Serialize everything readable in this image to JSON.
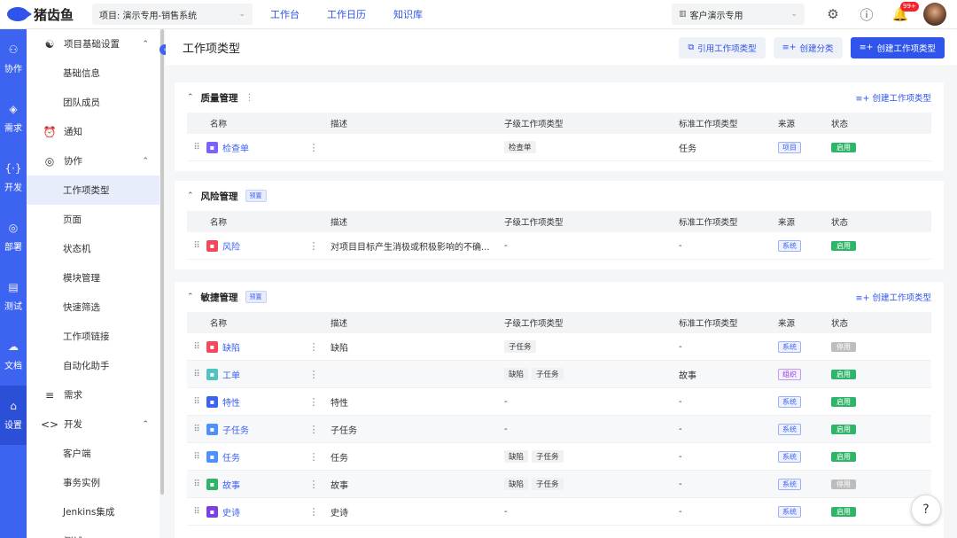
{
  "app": {
    "name": "猪齿鱼",
    "project_select": "项目: 演示专用-销售系统",
    "nav": [
      "工作台",
      "工作日历",
      "知识库"
    ],
    "client_select": "客户演示专用",
    "notification_badge": "99+"
  },
  "rail": [
    {
      "label": "协作",
      "icon": "users"
    },
    {
      "label": "需求",
      "icon": "layers"
    },
    {
      "label": "开发",
      "icon": "code"
    },
    {
      "label": "部署",
      "icon": "box"
    },
    {
      "label": "测试",
      "icon": "clipboard"
    },
    {
      "label": "文档",
      "icon": "cloud"
    },
    {
      "label": "设置",
      "icon": "settings"
    }
  ],
  "sidebar": {
    "group_basic": "项目基础设置",
    "basic_items": [
      "基础信息",
      "团队成员"
    ],
    "notify": "通知",
    "group_collab": "协作",
    "collab_items": [
      "工作项类型",
      "页面",
      "状态机",
      "模块管理",
      "快速筛选",
      "工作项链接",
      "自动化助手"
    ],
    "group_demand": "需求",
    "group_dev": "开发",
    "dev_items": [
      "客户端",
      "事务实例",
      "Jenkins集成"
    ],
    "partial": "测试"
  },
  "page": {
    "title": "工作项类型",
    "btn_ref": "引用工作项类型",
    "btn_create_cat": "创建分类",
    "btn_create_type": "创建工作项类型"
  },
  "table_headers": {
    "name": "名称",
    "desc": "描述",
    "sub": "子级工作项类型",
    "std": "标准工作项类型",
    "src": "来源",
    "status": "状态"
  },
  "sections": [
    {
      "title": "质量管理",
      "tag": "",
      "action": "创建工作项类型",
      "rows": [
        {
          "name": "检查单",
          "icon_color": "#7b61ff",
          "desc": "",
          "sub": [
            "检查单"
          ],
          "std": "任务",
          "src": "项目",
          "status": "启用"
        }
      ]
    },
    {
      "title": "风险管理",
      "tag": "预置",
      "action": "",
      "rows": [
        {
          "name": "风险",
          "icon_color": "#f5495b",
          "desc": "对项目目标产生消极或积极影响的不确...",
          "sub": [],
          "sub_text": "-",
          "std": "-",
          "src": "系统",
          "status": "启用"
        }
      ]
    },
    {
      "title": "敏捷管理",
      "tag": "预置",
      "action": "创建工作项类型",
      "rows": [
        {
          "name": "缺陷",
          "icon_color": "#f5495b",
          "desc": "缺陷",
          "sub": [
            "子任务"
          ],
          "std": "-",
          "src": "系统",
          "status": "停用"
        },
        {
          "name": "工单",
          "icon_color": "#4fc3c1",
          "desc": "",
          "sub": [
            "缺陷",
            "子任务"
          ],
          "std": "故事",
          "src": "组织",
          "status": "启用"
        },
        {
          "name": "特性",
          "icon_color": "#3d63f1",
          "desc": "特性",
          "sub": [],
          "sub_text": "-",
          "std": "-",
          "src": "系统",
          "status": "启用"
        },
        {
          "name": "子任务",
          "icon_color": "#4d90fe",
          "desc": "子任务",
          "sub": [],
          "sub_text": "-",
          "std": "-",
          "src": "系统",
          "status": "启用"
        },
        {
          "name": "任务",
          "icon_color": "#4d90fe",
          "desc": "任务",
          "sub": [
            "缺陷",
            "子任务"
          ],
          "std": "-",
          "src": "系统",
          "status": "启用"
        },
        {
          "name": "故事",
          "icon_color": "#2fb56a",
          "desc": "故事",
          "sub": [
            "缺陷",
            "子任务"
          ],
          "std": "-",
          "src": "系统",
          "status": "停用"
        },
        {
          "name": "史诗",
          "icon_color": "#7b3fe4",
          "desc": "史诗",
          "sub": [],
          "sub_text": "-",
          "std": "-",
          "src": "系统",
          "status": "启用"
        }
      ]
    }
  ]
}
